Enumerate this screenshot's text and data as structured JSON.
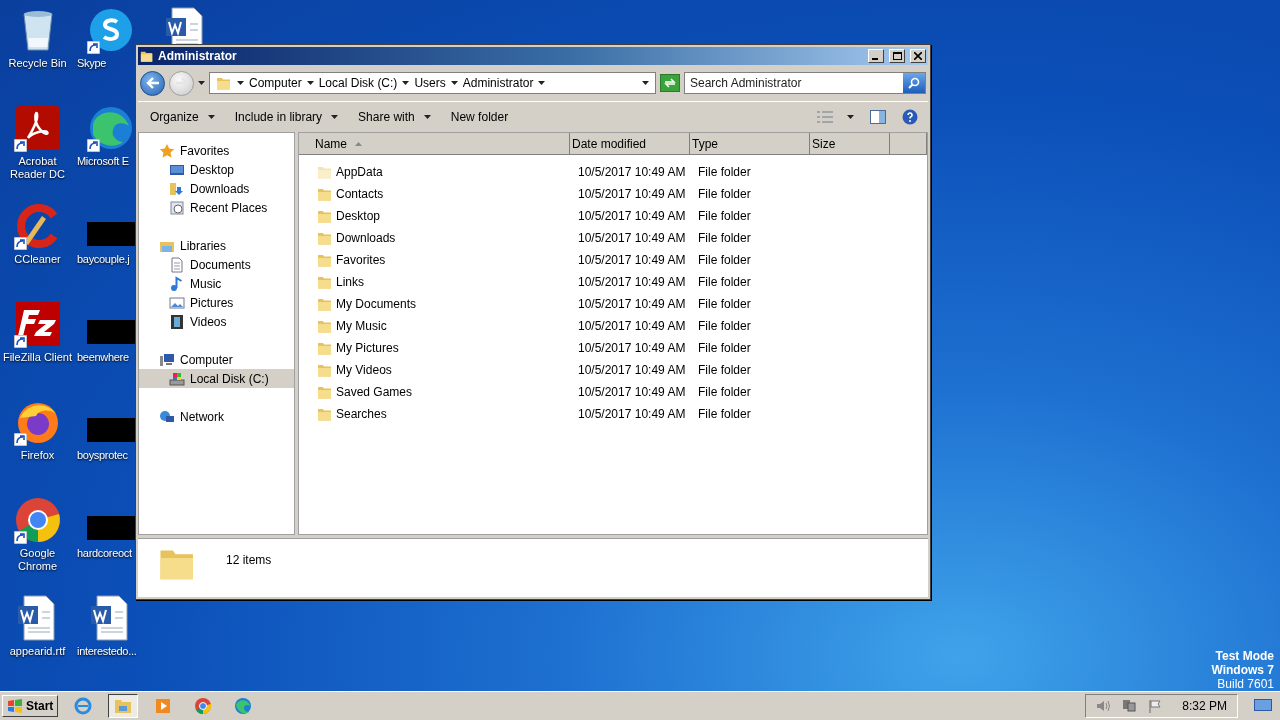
{
  "desktop_icons": [
    {
      "label": "Recycle Bin",
      "kind": "recycle",
      "shortcut": false
    },
    {
      "label": "Acrobat Reader DC",
      "kind": "acrobat",
      "shortcut": true
    },
    {
      "label": "CCleaner",
      "kind": "ccleaner",
      "shortcut": true
    },
    {
      "label": "FileZilla Client",
      "kind": "filezilla",
      "shortcut": true
    },
    {
      "label": "Firefox",
      "kind": "firefox",
      "shortcut": true
    },
    {
      "label": "Google Chrome",
      "kind": "chrome",
      "shortcut": true
    },
    {
      "label": "appearid.rtf",
      "kind": "word",
      "shortcut": false
    },
    {
      "label": "Skype",
      "kind": "skype",
      "shortcut": true
    },
    {
      "label": "Microsoft E",
      "kind": "edge",
      "shortcut": true
    },
    {
      "label": "baycouple.j",
      "kind": "redacted",
      "shortcut": false
    },
    {
      "label": "beenwhere",
      "kind": "redacted",
      "shortcut": false
    },
    {
      "label": "boysprotec",
      "kind": "redacted",
      "shortcut": false
    },
    {
      "label": "hardcoreoct",
      "kind": "redacted",
      "shortcut": false
    },
    {
      "label": "interestedo...",
      "kind": "word",
      "shortcut": false
    },
    {
      "kind": "word",
      "shortcut": false
    }
  ],
  "window": {
    "title": "Administrator",
    "address": {
      "crumbs": [
        "Computer",
        "Local Disk (C:)",
        "Users",
        "Administrator"
      ]
    },
    "search": {
      "placeholder": "Search Administrator"
    },
    "toolbar": [
      {
        "label": "Organize",
        "menu": true
      },
      {
        "label": "Include in library",
        "menu": true
      },
      {
        "label": "Share with",
        "menu": true
      },
      {
        "label": "New folder",
        "menu": false
      }
    ],
    "nav": [
      {
        "label": "Favorites",
        "kind": "star",
        "selected": false,
        "children": [
          {
            "label": "Desktop",
            "kind": "desktop",
            "selected": false
          },
          {
            "label": "Downloads",
            "kind": "downloads",
            "selected": false
          },
          {
            "label": "Recent Places",
            "kind": "recent",
            "selected": false
          }
        ]
      },
      {
        "label": "Libraries",
        "kind": "libraries",
        "selected": false,
        "children": [
          {
            "label": "Documents",
            "kind": "documents",
            "selected": false
          },
          {
            "label": "Music",
            "kind": "music",
            "selected": false
          },
          {
            "label": "Pictures",
            "kind": "pictures",
            "selected": false
          },
          {
            "label": "Videos",
            "kind": "videos",
            "selected": false
          }
        ]
      },
      {
        "label": "Computer",
        "kind": "computer",
        "selected": false,
        "children": [
          {
            "label": "Local Disk (C:)",
            "kind": "disk",
            "selected": true
          }
        ]
      },
      {
        "label": "Network",
        "kind": "network",
        "selected": false
      }
    ],
    "columns": [
      {
        "label": "Name",
        "sorted": true
      },
      {
        "label": "Date modified",
        "sorted": false
      },
      {
        "label": "Type",
        "sorted": false
      },
      {
        "label": "Size",
        "sorted": false
      }
    ],
    "rows": [
      {
        "name": "AppData",
        "date": "10/5/2017 10:49 AM",
        "type": "File folder",
        "hidden": true
      },
      {
        "name": "Contacts",
        "date": "10/5/2017 10:49 AM",
        "type": "File folder",
        "hidden": false
      },
      {
        "name": "Desktop",
        "date": "10/5/2017 10:49 AM",
        "type": "File folder",
        "hidden": false
      },
      {
        "name": "Downloads",
        "date": "10/5/2017 10:49 AM",
        "type": "File folder",
        "hidden": false
      },
      {
        "name": "Favorites",
        "date": "10/5/2017 10:49 AM",
        "type": "File folder",
        "hidden": false
      },
      {
        "name": "Links",
        "date": "10/5/2017 10:49 AM",
        "type": "File folder",
        "hidden": false
      },
      {
        "name": "My Documents",
        "date": "10/5/2017 10:49 AM",
        "type": "File folder",
        "hidden": false
      },
      {
        "name": "My Music",
        "date": "10/5/2017 10:49 AM",
        "type": "File folder",
        "hidden": false
      },
      {
        "name": "My Pictures",
        "date": "10/5/2017 10:49 AM",
        "type": "File folder",
        "hidden": false
      },
      {
        "name": "My Videos",
        "date": "10/5/2017 10:49 AM",
        "type": "File folder",
        "hidden": false
      },
      {
        "name": "Saved Games",
        "date": "10/5/2017 10:49 AM",
        "type": "File folder",
        "hidden": false
      },
      {
        "name": "Searches",
        "date": "10/5/2017 10:49 AM",
        "type": "File folder",
        "hidden": false
      }
    ],
    "details": {
      "count": "12 items"
    }
  },
  "os_notice": [
    "Test Mode",
    "Windows 7",
    "Build 7601"
  ],
  "taskbar": {
    "start": "Start",
    "apps": [
      {
        "kind": "ie",
        "selected": false
      },
      {
        "kind": "explorer",
        "selected": true
      },
      {
        "kind": "media",
        "selected": false
      },
      {
        "kind": "chrome",
        "selected": false
      },
      {
        "kind": "edge",
        "selected": false
      }
    ],
    "clock": "8:32 PM"
  }
}
